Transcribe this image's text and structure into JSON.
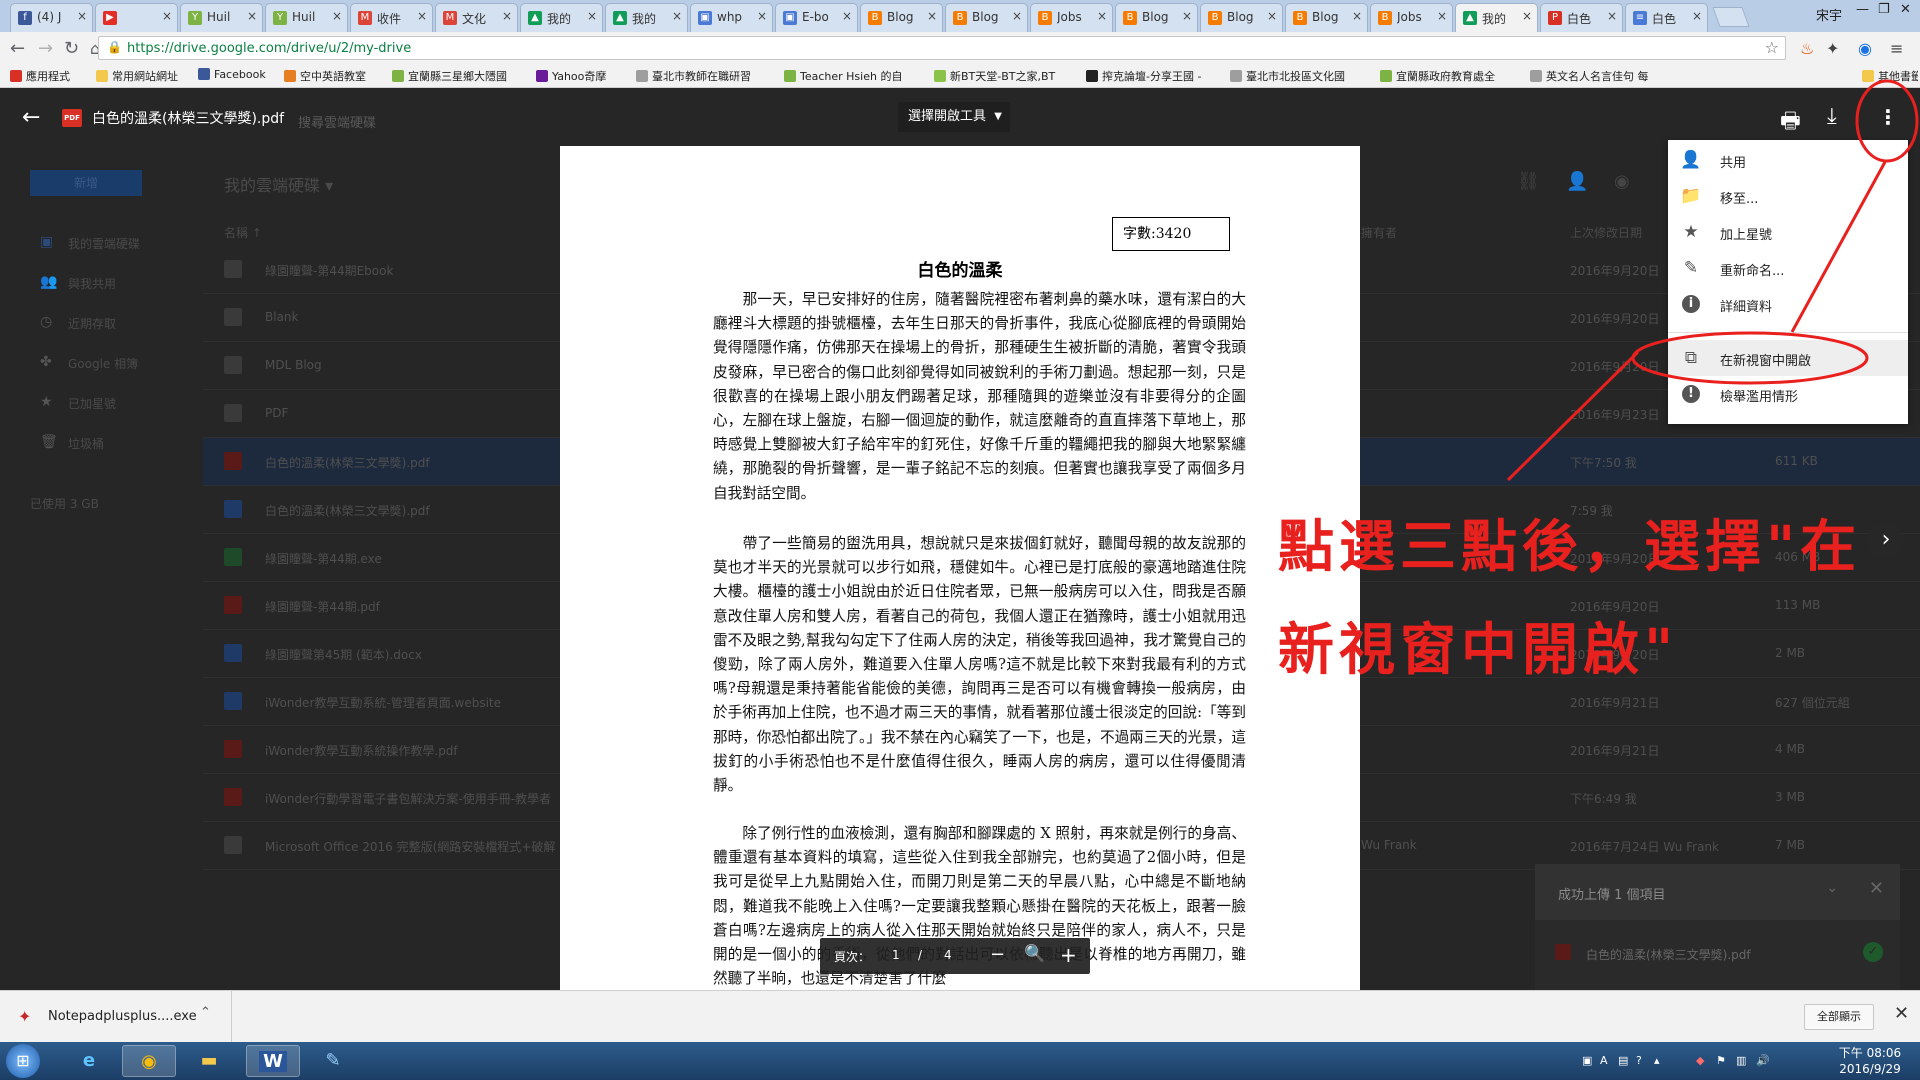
{
  "browser": {
    "tabs": [
      {
        "label": "(4) J",
        "color": "#3b5998",
        "icon": "facebook-icon",
        "glyph": "f"
      },
      {
        "label": "",
        "color": "#e52d27",
        "icon": "youtube-icon",
        "glyph": "▶"
      },
      {
        "label": "Huil",
        "color": "#7cb342",
        "icon": "tab-y-icon",
        "glyph": "Y"
      },
      {
        "label": "Huil",
        "color": "#7cb342",
        "icon": "tab-y-icon",
        "glyph": "Y"
      },
      {
        "label": "收件",
        "color": "#db4437",
        "icon": "gmail-icon",
        "glyph": "M"
      },
      {
        "label": "文化",
        "color": "#db4437",
        "icon": "gmail-icon",
        "glyph": "M"
      },
      {
        "label": "我的",
        "color": "#0f9d58",
        "icon": "drive-icon",
        "glyph": "▲"
      },
      {
        "label": "我的",
        "color": "#0f9d58",
        "icon": "drive-icon",
        "glyph": "▲"
      },
      {
        "label": "whp",
        "color": "#4a7ad6",
        "icon": "page-icon",
        "glyph": "▣"
      },
      {
        "label": "E-bo",
        "color": "#4a7ad6",
        "icon": "page-icon",
        "glyph": "▣"
      },
      {
        "label": "Blog",
        "color": "#f57c00",
        "icon": "blogger-icon",
        "glyph": "B"
      },
      {
        "label": "Blog",
        "color": "#f57c00",
        "icon": "blogger-icon",
        "glyph": "B"
      },
      {
        "label": "Jobs",
        "color": "#f57c00",
        "icon": "blogger-icon",
        "glyph": "B"
      },
      {
        "label": "Blog",
        "color": "#f57c00",
        "icon": "blogger-icon",
        "glyph": "B"
      },
      {
        "label": "Blog",
        "color": "#f57c00",
        "icon": "blogger-icon",
        "glyph": "B"
      },
      {
        "label": "Blog",
        "color": "#f57c00",
        "icon": "blogger-icon",
        "glyph": "B"
      },
      {
        "label": "Jobs",
        "color": "#f57c00",
        "icon": "blogger-icon",
        "glyph": "B"
      },
      {
        "label": "我的",
        "color": "#0f9d58",
        "icon": "drive-icon",
        "glyph": "▲",
        "active": true
      },
      {
        "label": "白色",
        "color": "#d93025",
        "icon": "pdf-icon",
        "glyph": "P"
      },
      {
        "label": "白色",
        "color": "#4a7ad6",
        "icon": "doc-icon",
        "glyph": "≡"
      }
    ],
    "profile": "宋宇",
    "url": "https://drive.google.com/drive/u/2/my-drive",
    "bookmarks": [
      {
        "label": "應用程式",
        "color": "#d93025"
      },
      {
        "label": "常用網站網址",
        "color": "#f2c94c"
      },
      {
        "label": "Facebook",
        "color": "#3b5998"
      },
      {
        "label": "空中英語教室",
        "color": "#e67e22"
      },
      {
        "label": "宜蘭縣三星鄉大隱國",
        "color": "#7cb342"
      },
      {
        "label": "Yahoo奇摩",
        "color": "#6a1b9a"
      },
      {
        "label": "臺北市教師在職研習",
        "color": "#9e9e9e"
      },
      {
        "label": "Teacher Hsieh 的自",
        "color": "#7cb342"
      },
      {
        "label": "新BT天堂-BT之家,BT",
        "color": "#8bc34a"
      },
      {
        "label": "搾克論壇-分享王國 -",
        "color": "#222222"
      },
      {
        "label": "臺北市北投區文化國",
        "color": "#9e9e9e"
      },
      {
        "label": "宜蘭縣政府教育處全",
        "color": "#7cb342"
      },
      {
        "label": "英文名人名言佳句 每",
        "color": "#9e9e9e"
      },
      {
        "label": "其他書籤",
        "color": "#f2c94c"
      }
    ]
  },
  "drive": {
    "new_label": "新增",
    "breadcrumb": "我的雲端硬碟 ▾",
    "sidebar": [
      {
        "label": "我的雲端硬碟",
        "icon": "my-drive-icon",
        "glyph": "▣"
      },
      {
        "label": "與我共用",
        "icon": "shared-icon",
        "glyph": "👥"
      },
      {
        "label": "近期存取",
        "icon": "recent-icon",
        "glyph": "◷"
      },
      {
        "label": "Google 相簿",
        "icon": "photos-icon",
        "glyph": "✤"
      },
      {
        "label": "已加星號",
        "icon": "starred-icon",
        "glyph": "★"
      },
      {
        "label": "垃圾桶",
        "icon": "trash-icon",
        "glyph": "🗑"
      }
    ],
    "storage": "已使用 3 GB",
    "columns": {
      "name": "名稱 ↑",
      "owner": "擁有者",
      "modified": "上次修改日期",
      "size": "檔案大小"
    },
    "files": [
      {
        "name": "綠園瞳聲-第44期Ebook",
        "modified": "2016年9月20日",
        "size": "",
        "owner": "",
        "type": "folder"
      },
      {
        "name": "Blank",
        "modified": "2016年9月20日",
        "size": "",
        "owner": "",
        "type": "folder"
      },
      {
        "name": "MDL Blog",
        "modified": "2016年9月20日",
        "size": "",
        "owner": "",
        "type": "folder"
      },
      {
        "name": "PDF",
        "modified": "2016年9月23日",
        "size": "",
        "owner": "",
        "type": "folder"
      },
      {
        "name": "白色的溫柔(林榮三文學獎).pdf",
        "modified": "下午7:50 我",
        "size": "611 KB",
        "owner": "",
        "type": "pdf",
        "selected": true
      },
      {
        "name": "白色的溫柔(林榮三文學獎).pdf",
        "modified": "7:59 我",
        "size": "",
        "owner": "",
        "type": "doc"
      },
      {
        "name": "綠園瞳聲-第44期.exe",
        "modified": "2016年9月20日",
        "size": "406 MB",
        "owner": "",
        "type": "exe"
      },
      {
        "name": "綠園瞳聲-第44期.pdf",
        "modified": "2016年9月20日",
        "size": "113 MB",
        "owner": "",
        "type": "pdf"
      },
      {
        "name": "綠園瞳聲第45期 (範本).docx",
        "modified": "2016年9月20日",
        "size": "2 MB",
        "owner": "",
        "type": "word"
      },
      {
        "name": "iWonder教學互動系統-管理者頁面.website",
        "modified": "2016年9月21日",
        "size": "627 個位元組",
        "owner": "",
        "type": "site"
      },
      {
        "name": "iWonder教學互動系統操作教學.pdf",
        "modified": "2016年9月21日",
        "size": "4 MB",
        "owner": "",
        "type": "pdf"
      },
      {
        "name": "iWonder行動學習電子書包解決方案-使用手冊-教學者",
        "modified": "下午6:49 我",
        "size": "3 MB",
        "owner": "",
        "type": "pdf"
      },
      {
        "name": "Microsoft Office 2016 完整版(網路安裝檔程式+破解",
        "modified": "2016年7月24日 Wu Frank",
        "size": "7 MB",
        "owner": "Wu Frank",
        "type": "zip"
      }
    ]
  },
  "viewer": {
    "file_title": "白色的溫柔(林榮三文學獎).pdf",
    "search_placeholder": "搜尋雲端硬碟",
    "open_with": "選擇開啟工具",
    "page_label": "頁次：",
    "page_current": "1",
    "page_sep": "/",
    "page_total": "4"
  },
  "pdf": {
    "word_count": "字數:3420",
    "title": "白色的溫柔",
    "paragraphs": [
      "　　那一天，早已安排好的住房，隨著醫院裡密布著刺鼻的藥水味，還有潔白的大廳裡斗大標題的掛號櫃檯，去年生日那天的骨折事件，我底心從腳底裡的骨頭開始覺得隱隱作痛，仿佛那天在操場上的骨折，那種硬生生被折斷的清脆，著實令我頭皮發麻，早已密合的傷口此刻卻覺得如同被銳利的手術刀劃過。想起那一刻，只是很歡喜的在操場上跟小朋友們踢著足球，那種隨興的遊樂並沒有非要得分的企圖心，左腳在球上盤旋，右腳一個迴旋的動作，就這麼離奇的直直摔落下草地上，那時感覺上雙腳被大釘子給牢牢的釘死住，好像千斤重的韁繩把我的腳與大地緊緊纏繞，那脆裂的骨折聲響，是一輩子銘記不忘的刻痕。但著實也讓我享受了兩個多月自我對話空間。",
      "　　帶了一些簡易的盥洗用具，想說就只是來拔個釘就好，聽聞母親的故友說那的莫也才半天的光景就可以步行如飛，穩健如牛。心裡已是打底般的豪邁地踏進住院大樓。櫃檯的護士小姐說由於近日住院者眾，已無一般病房可以入住，問我是否願意改住單人房和雙人房，看著自己的荷包，我個人還正在猶豫時，護士小姐就用迅雷不及眼之勢,幫我勾勾定下了住兩人房的決定，稍後等我回過神，我才驚覺自己的傻勁，除了兩人房外，難道要入住單人房嗎?這不就是比較下來對我最有利的方式嗎?母親還是秉持著能省能儉的美德，詢問再三是否可以有機會轉換一般病房，由於手術再加上住院，也不過才兩三天的事情，就看著那位護士很淡定的回說:「等到那時，你恐怕都出院了。」我不禁在內心竊笑了一下，也是，不過兩三天的光景，這拔釘的小手術恐怕也不是什麼值得住很久，睡兩人房的病房，還可以住得優閒清靜。",
      "　　除了例行性的血液檢測，還有胸部和腳踝處的 X 照射，再來就是例行的身高、體重還有基本資料的填寫，這些從入住到我全部辦完，也約莫過了2個小時，但是我可是從早上九點開始入住，而開刀則是第二天的早晨八點，心中總是不斷地納悶，難道我不能晚上入住嗎?一定要讓我整顆心懸掛在醫院的天花板上，跟著一臉蒼白嗎?左邊病房上的病人從入住那天開始就始終只是陪伴的家人，病人不，只是開的是一個小的的手術，從他們的對話出可以依稀聽出是以脊椎的地方再開刀，雖然聽了半晌，也還是不清楚害了什麼"
    ]
  },
  "menu": [
    {
      "label": "共用",
      "icon": "add-person-icon",
      "glyph": "👤"
    },
    {
      "label": "移至...",
      "icon": "move-to-folder-icon",
      "glyph": "📁"
    },
    {
      "label": "加上星號",
      "icon": "star-icon",
      "glyph": "★"
    },
    {
      "label": "重新命名...",
      "icon": "rename-pencil-icon",
      "glyph": "✎"
    },
    {
      "label": "詳細資料",
      "icon": "info-icon",
      "glyph": "ⓘ"
    },
    {
      "label": "在新視窗中開啟",
      "icon": "open-in-new-window-icon",
      "glyph": "⧉",
      "highlight": true
    },
    {
      "label": "檢舉濫用情形",
      "icon": "report-icon",
      "glyph": "!"
    }
  ],
  "annotation": {
    "line1": "點選三點後，選擇\"在",
    "line2": "新視窗中開啟\"",
    "color": "#e8201e"
  },
  "upload_toast": {
    "title": "成功上傳 1 個項目",
    "file": "白色的溫柔(林榮三文學獎).pdf"
  },
  "downloads": {
    "file": "Notepadplusplus....exe",
    "show_all": "全部顯示"
  },
  "taskbar": {
    "time": "下午 08:06",
    "date": "2016/9/29"
  }
}
